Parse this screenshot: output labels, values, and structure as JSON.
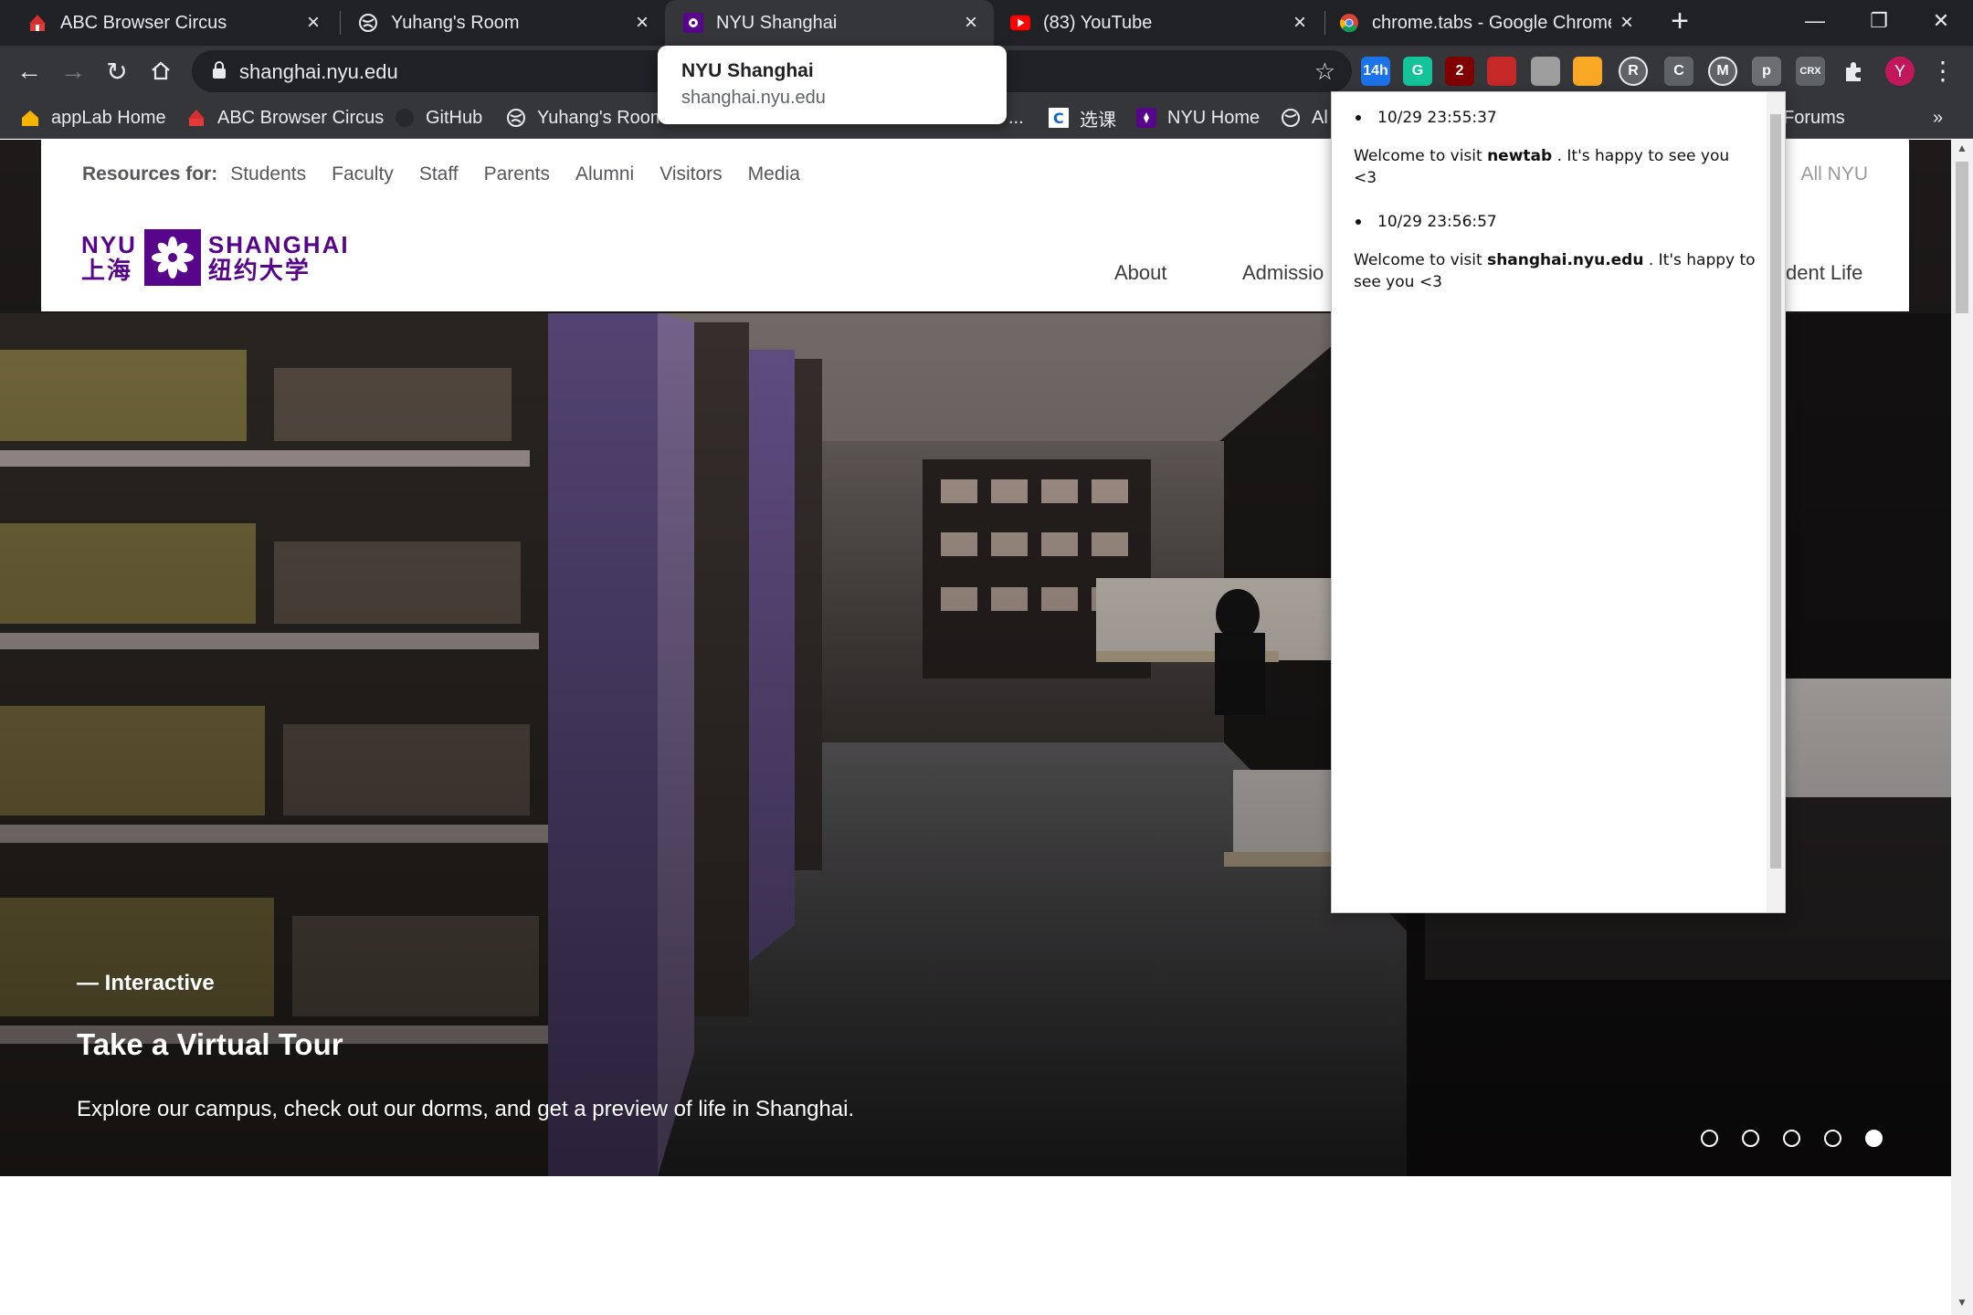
{
  "browser": {
    "tabs": [
      {
        "title": "ABC Browser Circus",
        "icon": "circus-tent-icon",
        "active": false
      },
      {
        "title": "Yuhang's Room",
        "icon": "globe-icon",
        "active": false
      },
      {
        "title": "NYU Shanghai",
        "icon": "nyu-torch-icon",
        "active": true
      },
      {
        "title": "(83) YouTube",
        "icon": "youtube-icon",
        "active": false
      },
      {
        "title": "chrome.tabs - Google Chrome",
        "icon": "chrome-icon",
        "active": false
      }
    ],
    "address_url": "shanghai.nyu.edu",
    "tooltip": {
      "title": "NYU Shanghai",
      "url": "shanghai.nyu.edu"
    },
    "extensions": [
      {
        "label": "14h",
        "color": "#1a73e8"
      },
      {
        "label": "G",
        "color": "#15c39a"
      },
      {
        "label": "2",
        "color": "#800000"
      },
      {
        "label": "",
        "color": "#c62828"
      },
      {
        "label": "",
        "color": "#9e9e9e"
      },
      {
        "label": "",
        "color": "#f9a825"
      },
      {
        "label": "R",
        "color": "#5f6368"
      },
      {
        "label": "C",
        "color": "#5f6368"
      },
      {
        "label": "M",
        "color": "#5f6368"
      },
      {
        "label": "p",
        "color": "#6d6e72"
      },
      {
        "label": "CRX",
        "color": "#5f6368"
      }
    ],
    "profile_initial": "Y",
    "bookmarks": [
      {
        "label": "appLab Home",
        "icon": "house-icon"
      },
      {
        "label": "ABC Browser Circus",
        "icon": "circus-tent-icon"
      },
      {
        "label": "GitHub",
        "icon": "github-icon"
      },
      {
        "label": "Yuhang's Room",
        "icon": "globe-icon"
      },
      {
        "label": "...",
        "icon": ""
      },
      {
        "label": "选课",
        "icon": "letter-c-icon"
      },
      {
        "label": "NYU Home",
        "icon": "nyu-torch-icon"
      },
      {
        "label": "Al",
        "icon": "globe-icon"
      },
      {
        "label": "Forums",
        "icon": "forums-icon"
      }
    ],
    "bookmarks_overflow": "»"
  },
  "site": {
    "resources_label": "Resources for:",
    "resources_links": [
      "Students",
      "Faculty",
      "Staff",
      "Parents",
      "Alumni",
      "Visitors",
      "Media"
    ],
    "all_nyu": "All NYU",
    "logo": {
      "nyu": "NYU",
      "cn_left": "上海",
      "shanghai": "SHANGHAI",
      "cn_right": "纽约大学"
    },
    "nav": [
      "About",
      "Admissio",
      "dent Life"
    ],
    "hero": {
      "eyebrow": "— Interactive",
      "title": "Take a Virtual Tour",
      "description": "Explore our campus, check out our dorms, and get a preview of life in Shanghai.",
      "slides_total": 5,
      "active_slide": 5
    }
  },
  "popup": {
    "entries": [
      {
        "time": "10/29 23:55:37",
        "prefix": "Welcome to visit",
        "domain": "newtab",
        "suffix": ". It's happy to see you <3"
      },
      {
        "time": "10/29 23:56:57",
        "prefix": "Welcome to visit",
        "domain": "shanghai.nyu.edu",
        "suffix": ". It's happy to see you <3"
      }
    ]
  }
}
